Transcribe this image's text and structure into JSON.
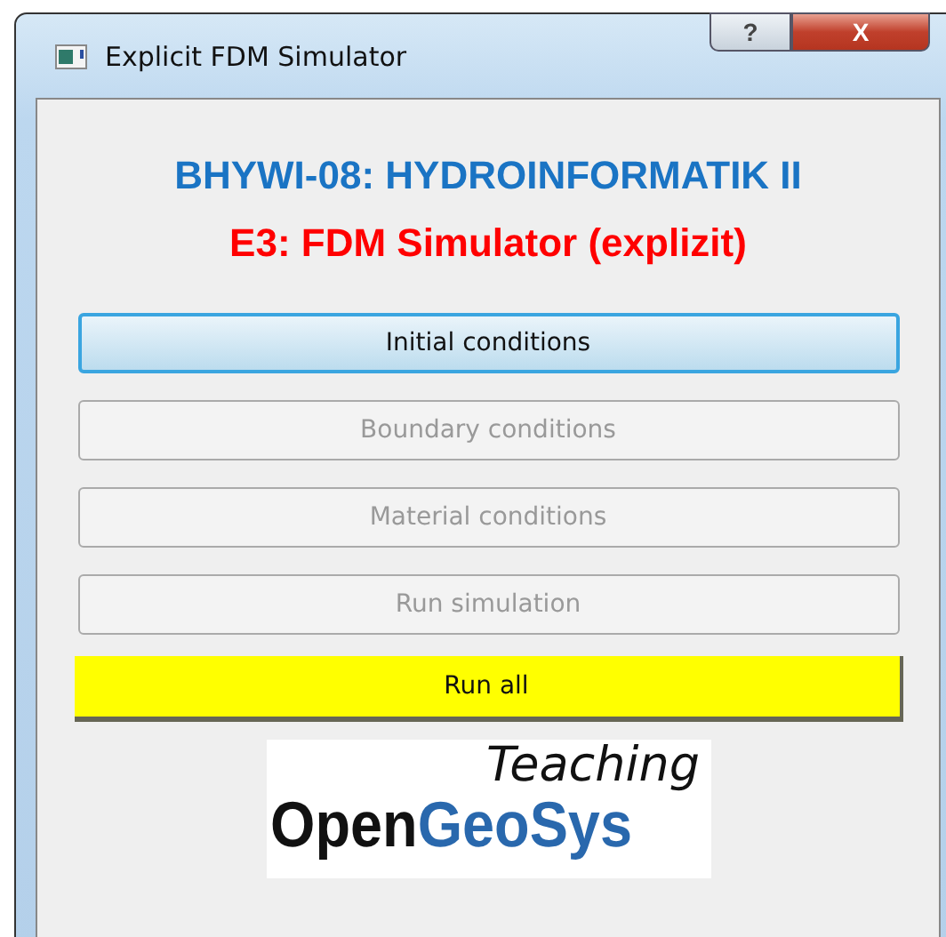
{
  "window": {
    "title": "Explicit FDM Simulator",
    "help_glyph": "?",
    "close_glyph": "X"
  },
  "heading": {
    "course": "BHYWI-08: HYDROINFORMATIK II",
    "exercise": "E3: FDM Simulator (explizit)"
  },
  "buttons": [
    {
      "label": "Initial conditions",
      "kind": "standard",
      "focused": true,
      "disabled": false
    },
    {
      "label": "Boundary conditions",
      "kind": "standard",
      "focused": false,
      "disabled": true
    },
    {
      "label": "Material conditions",
      "kind": "standard",
      "focused": false,
      "disabled": true
    },
    {
      "label": "Run simulation",
      "kind": "standard",
      "focused": false,
      "disabled": true
    },
    {
      "label": "Run all",
      "kind": "accent",
      "focused": false,
      "disabled": false
    }
  ],
  "logo": {
    "tagline": "Teaching",
    "name_dark": "Open",
    "name_blue": "GeoSys"
  }
}
